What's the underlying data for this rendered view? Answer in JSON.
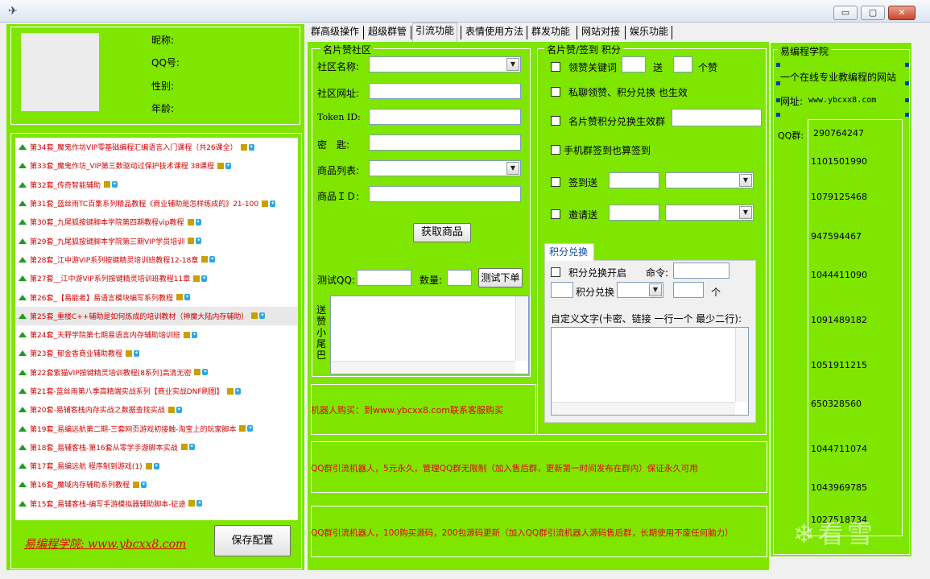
{
  "window": {
    "min_glyph": "▭",
    "max_glyph": "▢",
    "close_glyph": "✕"
  },
  "profile": {
    "nickname_label": "昵称:",
    "qq_label": "QQ号:",
    "gender_label": "性别:",
    "age_label": "年龄:"
  },
  "courses": [
    "第34套_魔鬼作坊VIP零基础编程汇编语言入门课程（共26课全）",
    "第33套_魔鬼作坊_VIP第三数驱动过保护技术课程 38课程",
    "第32套_传奇智能辅助",
    "第31套_蓝丝雨TC百集系列精品教程《商业辅助是怎样练成的》21-100",
    "第30套_九尾狐按键脚本学院第四期教程vip教程",
    "第29套_九尾狐按键脚本学院第三期VIP学员培训",
    "第28套_江中游VIP系列按键精灵培训班教程12-18章",
    "第27套__江中游VIP系列按键精灵培训班教程11章",
    "第26套_【易能者】易语言模块编写系列教程",
    "第25套_重楼C++辅助是如何炼成的培训教材（神魔大陆内存辅助）",
    "第24套_天野学院第七期易语言内存辅助培训班",
    "第23套_郁金香商业辅助教程",
    "第22套紫猫VIP按键精灵培训教程[8系列]高清无密",
    "第21套-蓝丝雨第八季高精端实战系列【商业实战DNF刷图】",
    "第20套-易辅客栈内存实战之数据查找实战",
    "第19套_易编远航第二期-三套网页游戏初接触-淘宝上的玩家脚本",
    "第18套_易辅客栈-第16套从零学手游脚本实战",
    "第17套_易编远航 程序制到游戏(1)",
    "第16套_魔域内存辅助系列教程",
    "第15套_易辅客栈-编写手游模拟器辅助脚本-征途"
  ],
  "footer": {
    "site_link": "易编程学院: www.ybcxx8.com",
    "save_button": "保存配置"
  },
  "tabs": [
    "群高级操作",
    "超级群管",
    "引流功能",
    "表情使用方法",
    "群发功能",
    "网站对接",
    "娱乐功能"
  ],
  "active_tab": "引流功能",
  "community": {
    "title": "名片赞社区",
    "name_label": "社区名称:",
    "url_label": "社区网址:",
    "token_label": "Token ID:",
    "secret_label": "密　匙:",
    "goods_list_label": "商品列表:",
    "goods_id_label": "商品ＩＤ:",
    "fetch_button": "获取商品",
    "test_qq_label": "测试QQ:",
    "quantity_label": "数量:",
    "test_order_button": "测试下单",
    "tail_label": "送赞小尾巴"
  },
  "like_signin": {
    "title": "名片赞/签到 积分",
    "keyword_label": "领赞关键词",
    "send_label": "送",
    "likes_unit": "个赞",
    "private_label": "私聊领赞、积分兑换 也生效",
    "exchange_group_label": "名片赞积分兑换生效群",
    "phone_signin_label": "手机群签到也算签到",
    "signin_send_label": "签到送",
    "invite_send_label": "邀请送"
  },
  "points": {
    "tab_label": "积分兑换",
    "enable_label": "积分兑换开启",
    "command_label": "命令:",
    "exchange_label": "积分兑换",
    "unit_label": "个",
    "custom_text_label": "自定义文字(卡密、链接 一行一个 最少二行):"
  },
  "ads": {
    "buy_robot": "机器人购买：到www.ybcxx8.com联系客服购买",
    "line1": "QQ群引流机器人，5元永久，管理QQ群无限制（加入售后群，更新第一时间发布在群内）保证永久可用",
    "line2": "QQ群引流机器人，100购买源码，200包源码更新（加入QQ群引流机器人源码售后群，长期使用不废任何脑力）"
  },
  "academy": {
    "title": "易编程学院",
    "slogan": "一个在线专业教编程的网站",
    "url_label": "网址:",
    "url": "www.ybcxx8.com",
    "qq_group_label": "QQ群:",
    "qq_groups": [
      "290764247",
      "1101501990",
      "1079125468",
      "947594467",
      "1044411090",
      "1091489182",
      "1051911215",
      "650328560",
      "1044711074",
      "1043969785",
      "1027518734"
    ]
  },
  "watermark": "看雪",
  "colors": {
    "panel_green": "#7fe600",
    "ad_red": "#e60000",
    "link_red": "#d40000"
  }
}
